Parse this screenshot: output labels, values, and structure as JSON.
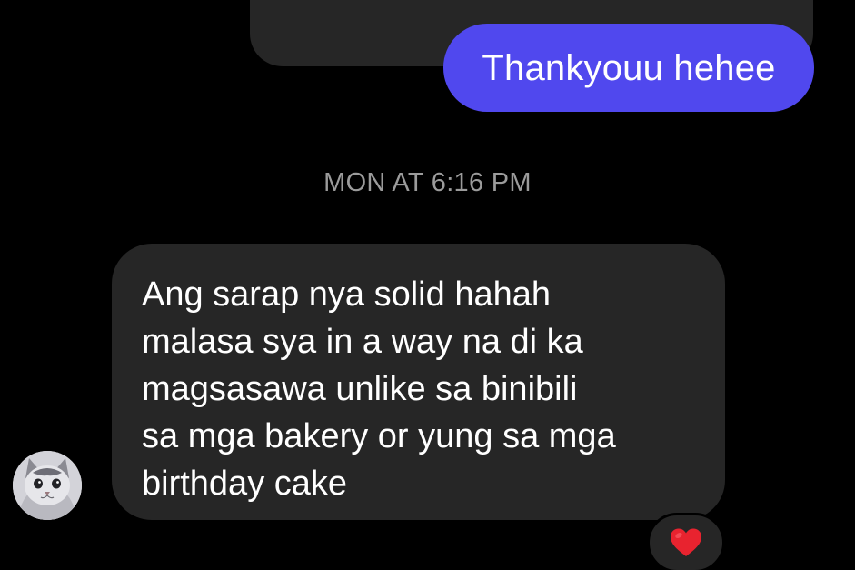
{
  "conversation": {
    "sent_message": {
      "text": "Thankyouu hehee",
      "bubble_color": "#5048ee"
    },
    "timestamp": "MON AT 6:16 PM",
    "received_message": {
      "text": "Ang sarap nya solid hahah\nmalasa sya in a way na di ka\nmagsasawa unlike sa binibili\nsa mga bakery or yung sa mga\nbirthday cake",
      "bubble_color": "#262626"
    },
    "reaction": {
      "icon": "heart-icon",
      "color": "#e8232f"
    },
    "avatar": {
      "icon": "cat-avatar-icon"
    }
  }
}
